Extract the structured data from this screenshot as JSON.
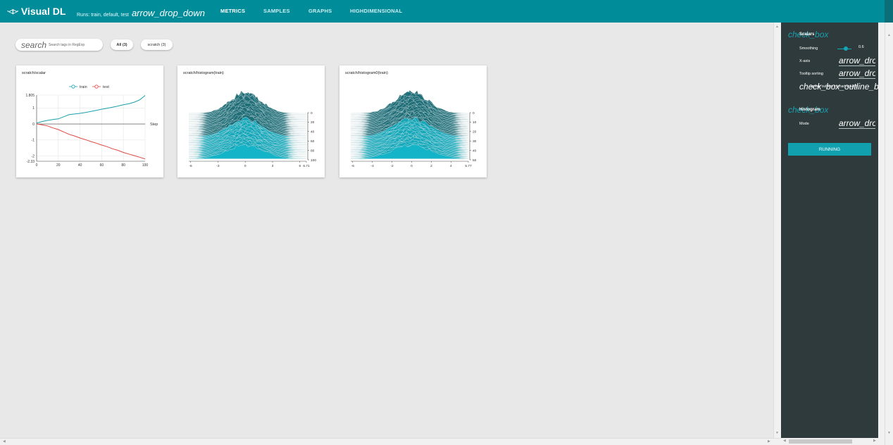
{
  "app": {
    "title": "Visual DL",
    "logo_mark": "·◁▷·"
  },
  "runs": {
    "label": "Runs: train, default, test",
    "dropdown_icon_text": "arrow_drop_down"
  },
  "nav": [
    {
      "label": "METRICS",
      "active": true
    },
    {
      "label": "SAMPLES",
      "active": false
    },
    {
      "label": "GRAPHS",
      "active": false
    },
    {
      "label": "HIGHDIMENSIONAL",
      "active": false
    }
  ],
  "search": {
    "icon_text": "search",
    "placeholder": "Search tags in RegExp"
  },
  "tag_chips": [
    {
      "label": "All  (3)",
      "active": true
    },
    {
      "label": "scratch  (3)",
      "active": false
    }
  ],
  "cards": [
    {
      "title": "scratch/scalar"
    },
    {
      "title": "scratch/histogram(train)"
    },
    {
      "title": "scratch/histogram0(train)"
    }
  ],
  "chart_data": [
    {
      "type": "line",
      "xlabel": "Step",
      "ylabel": "",
      "xlim": [
        0,
        100
      ],
      "ylim": [
        -2.33,
        1.805
      ],
      "x_ticks": [
        "0",
        "20",
        "40",
        "60",
        "80",
        "100"
      ],
      "y_ticks": [
        "1.805",
        "1",
        "0",
        "-1",
        "-2",
        "-2.33"
      ],
      "legend_position": "top",
      "grid": true,
      "x": [
        0,
        5,
        10,
        15,
        20,
        25,
        30,
        35,
        40,
        45,
        50,
        55,
        60,
        65,
        70,
        75,
        80,
        85,
        90,
        95,
        100
      ],
      "series": [
        {
          "name": "train",
          "color": "#1aa0a9",
          "values": [
            0.05,
            0.15,
            0.22,
            0.28,
            0.32,
            0.45,
            0.58,
            0.62,
            0.66,
            0.72,
            0.78,
            0.85,
            0.92,
            0.98,
            1.05,
            1.12,
            1.2,
            1.26,
            1.36,
            1.5,
            1.78
          ]
        },
        {
          "name": "test",
          "color": "#e0473f",
          "values": [
            0.0,
            -0.05,
            -0.12,
            -0.25,
            -0.35,
            -0.5,
            -0.65,
            -0.75,
            -0.88,
            -0.98,
            -1.1,
            -1.2,
            -1.32,
            -1.42,
            -1.55,
            -1.65,
            -1.78,
            -1.88,
            -1.98,
            -2.08,
            -2.18
          ]
        }
      ]
    },
    {
      "type": "area",
      "x_ticks": [
        "-6",
        "-3",
        "0",
        "3",
        "6",
        "6.71"
      ],
      "xlim": [
        -6.2,
        6.71
      ],
      "y_ticks": [
        "0",
        "20",
        "40",
        "60",
        "80",
        "100"
      ],
      "ylim": [
        0,
        100
      ],
      "color": "#13b5c8"
    },
    {
      "type": "area",
      "x_ticks": [
        "-6",
        "-4",
        "-2",
        "0",
        "2",
        "4",
        "5.77"
      ],
      "xlim": [
        -6.2,
        5.77
      ],
      "y_ticks": [
        "0",
        "10",
        "20",
        "30",
        "40",
        "50"
      ],
      "ylim": [
        0,
        50
      ],
      "color": "#13b5c8"
    }
  ],
  "panel": {
    "checkbox_icon_text": "check_box",
    "scalars_title": "Scalars",
    "smoothing_label": "Smoothing",
    "smoothing_value": "0.6",
    "smoothing_fraction": 0.6,
    "xaxis_label": "X-axis",
    "xaxis_select_text": "arrow_drop_down",
    "tooltip_label": "Tooltip sorting",
    "tooltip_select_text": "arrow_drop_down",
    "outline_checkbox_text": "check_box_outline_blank",
    "outline_checkbox_label": "Ignore outliers in chart scaling",
    "histogram_title": "Histogram",
    "mode_label": "Mode",
    "mode_select_text": "arrow_drop_down",
    "running_label": "RUNNING"
  }
}
